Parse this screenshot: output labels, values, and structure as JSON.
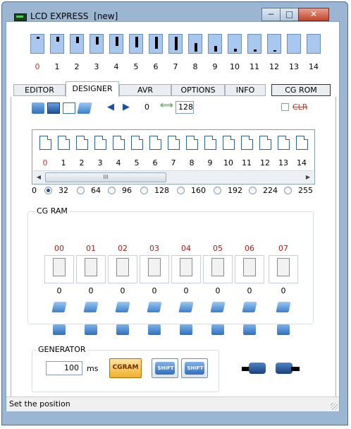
{
  "window": {
    "title": "LCD EXPRESS",
    "subtitle": "[new]",
    "minimize_glyph": "−",
    "maximize_glyph": "□",
    "close_glyph": "✕"
  },
  "channel_strip": {
    "labels": [
      "0",
      "1",
      "2",
      "3",
      "4",
      "5",
      "6",
      "7",
      "8",
      "9",
      "10",
      "11",
      "12",
      "13",
      "14"
    ],
    "active_label_color": "#c0392b"
  },
  "tabs": [
    {
      "label": "EDITOR"
    },
    {
      "label": "DESIGNER"
    },
    {
      "label": "AVR"
    },
    {
      "label": "OPTIONS"
    },
    {
      "label": "INFO"
    },
    {
      "label": "CG ROM"
    }
  ],
  "toolbar": {
    "position_value": "0",
    "swap_icon": "⟺",
    "length_value": "128",
    "clr_label": "CLR"
  },
  "pages": {
    "labels": [
      "0",
      "1",
      "2",
      "3",
      "4",
      "5",
      "6",
      "7",
      "8",
      "9",
      "10",
      "11",
      "12",
      "13",
      "14"
    ],
    "scroll_left": "◀",
    "scroll_right": "▶",
    "thumb_grip": "III"
  },
  "offsets": {
    "start_label": "0",
    "options": [
      "32",
      "64",
      "96",
      "128",
      "160",
      "192",
      "224",
      "255"
    ],
    "selected": "32"
  },
  "cgram": {
    "title": "CG RAM",
    "slots": [
      {
        "hex": "00",
        "value": "0"
      },
      {
        "hex": "01",
        "value": "0"
      },
      {
        "hex": "02",
        "value": "0"
      },
      {
        "hex": "03",
        "value": "0"
      },
      {
        "hex": "04",
        "value": "0"
      },
      {
        "hex": "05",
        "value": "0"
      },
      {
        "hex": "06",
        "value": "0"
      },
      {
        "hex": "07",
        "value": "0"
      }
    ]
  },
  "generator": {
    "title": "GENERATOR",
    "delay_value": "100",
    "delay_unit": "ms",
    "cgram_button_label": "CGRAM",
    "shift_left_label": "SHIFT",
    "shift_right_label": "SHIFT"
  },
  "status": {
    "text": "Set the position"
  },
  "colors": {
    "title_bar": "#9ab6d3",
    "channel_box": "#a8c8f0",
    "hex_label": "#a21e1e",
    "accent_blue": "#2d6fc1"
  },
  "icons": {
    "open": "open-folder-icon",
    "save": "save-disk-icon",
    "new": "new-document-icon",
    "erase": "eraser-icon",
    "arrow_left": "arrow-left-icon",
    "arrow_right": "arrow-right-icon",
    "swap": "swap-arrows-icon",
    "binoculars_left": "binoculars-left-icon",
    "binoculars_right": "binoculars-right-icon"
  }
}
